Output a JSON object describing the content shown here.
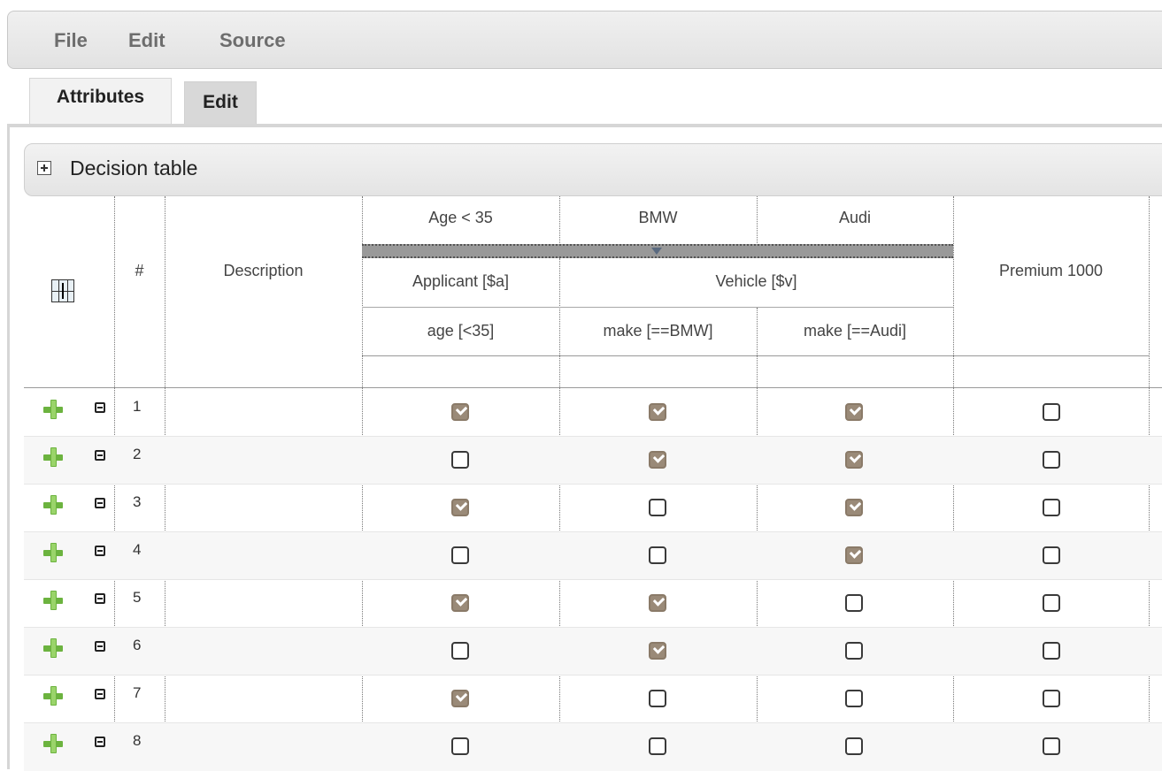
{
  "menu": {
    "file": "File",
    "edit": "Edit",
    "source": "Source"
  },
  "tabs": {
    "attributes": "Attributes",
    "edit": "Edit"
  },
  "section": {
    "title": "Decision table"
  },
  "table": {
    "number_header": "#",
    "description_header": "Description",
    "conditions": [
      {
        "header": "Age < 35",
        "field": "age [<35]"
      },
      {
        "header": "BMW",
        "field": "make [==BMW]"
      },
      {
        "header": "Audi",
        "field": "make [==Audi]"
      }
    ],
    "patterns": {
      "applicant": "Applicant [$a]",
      "vehicle": "Vehicle [$v]"
    },
    "action_header": "Premium 1000",
    "rows": [
      {
        "num": "1",
        "age": true,
        "bmw": true,
        "audi": true,
        "premium": false
      },
      {
        "num": "2",
        "age": false,
        "bmw": true,
        "audi": true,
        "premium": false
      },
      {
        "num": "3",
        "age": true,
        "bmw": false,
        "audi": true,
        "premium": false
      },
      {
        "num": "4",
        "age": false,
        "bmw": false,
        "audi": true,
        "premium": false
      },
      {
        "num": "5",
        "age": true,
        "bmw": true,
        "audi": false,
        "premium": false
      },
      {
        "num": "6",
        "age": false,
        "bmw": true,
        "audi": false,
        "premium": false
      },
      {
        "num": "7",
        "age": true,
        "bmw": false,
        "audi": false,
        "premium": false
      },
      {
        "num": "8",
        "age": false,
        "bmw": false,
        "audi": false,
        "premium": false
      }
    ]
  }
}
